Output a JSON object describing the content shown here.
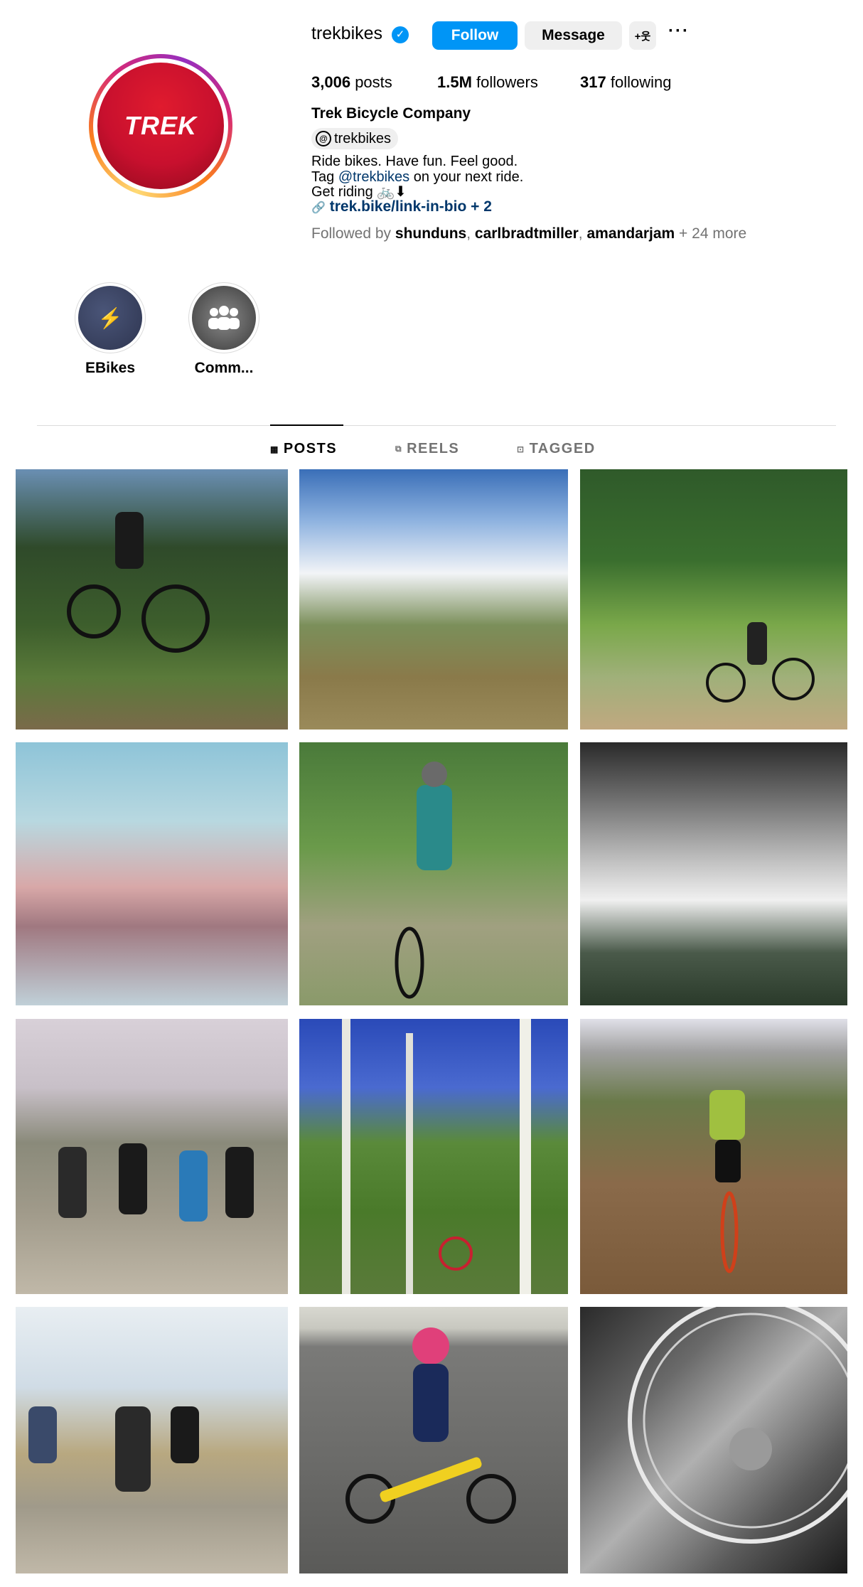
{
  "profile": {
    "avatar_text": "TREK",
    "username": "trekbikes",
    "verified_icon": "✓",
    "follow_label": "Follow",
    "message_label": "Message",
    "suggest_icon": "+웃",
    "more_icon": "···",
    "posts_count": "3,006",
    "posts_label": "posts",
    "followers_count": "1.5M",
    "followers_label": "followers",
    "following_count": "317",
    "following_label": "following",
    "full_name": "Trek Bicycle Company",
    "threads_handle": "trekbikes",
    "bio_line1": "Ride bikes. Have fun. Feel good.",
    "bio_line2_prefix": "Tag ",
    "bio_line2_mention": "@trekbikes",
    "bio_line2_suffix": " on your next ride.",
    "bio_line3": "Get riding 🚲⬇",
    "link_text": "trek.bike/link-in-bio + 2",
    "followed_by_prefix": "Followed by ",
    "followed_by_1": "shunduns",
    "followed_by_2": "carlbradtmiller",
    "followed_by_3": "amandarjam",
    "followed_by_more": " + 24 more"
  },
  "highlights": [
    {
      "label": "EBikes"
    },
    {
      "label": "Comm..."
    }
  ],
  "tabs": [
    {
      "label": "POSTS",
      "active": true
    },
    {
      "label": "REELS",
      "active": false
    },
    {
      "label": "TAGGED",
      "active": false
    }
  ],
  "colors": {
    "accent": "#0095f6",
    "trek_red": "#c8102e",
    "link": "#00376b"
  }
}
